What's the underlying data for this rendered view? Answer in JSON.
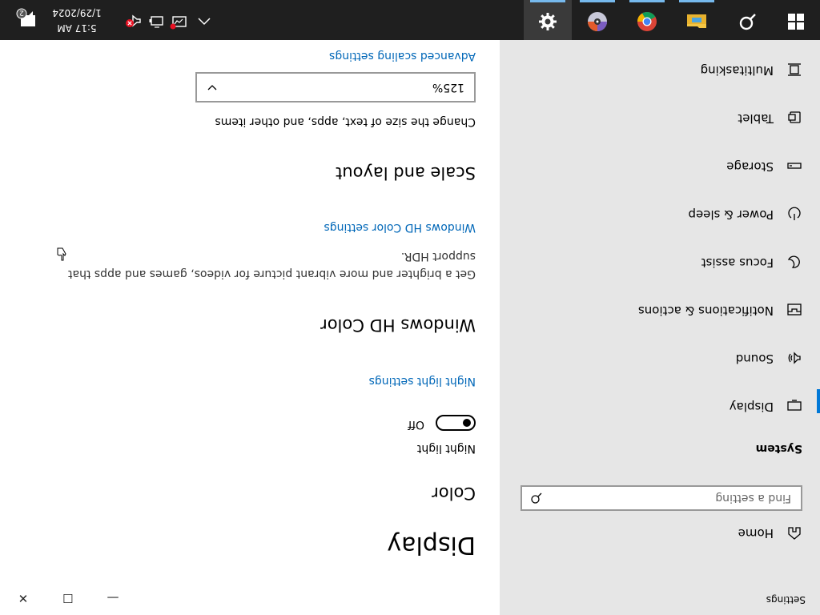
{
  "app": {
    "title": "Settings"
  },
  "sidebar": {
    "home_label": "Home",
    "search_placeholder": "Find a setting",
    "section_label": "System",
    "items": [
      {
        "label": "Display",
        "icon": "display-icon",
        "active": true
      },
      {
        "label": "Sound",
        "icon": "sound-icon"
      },
      {
        "label": "Notifications & actions",
        "icon": "notifications-icon"
      },
      {
        "label": "Focus assist",
        "icon": "focus-assist-icon"
      },
      {
        "label": "Power & sleep",
        "icon": "power-icon"
      },
      {
        "label": "Storage",
        "icon": "storage-icon"
      },
      {
        "label": "Tablet",
        "icon": "tablet-icon"
      },
      {
        "label": "Multitasking",
        "icon": "multitasking-icon"
      }
    ]
  },
  "window_controls": {
    "minimize": "—",
    "maximize": "☐",
    "close": "✕"
  },
  "main": {
    "title": "Display",
    "color_heading": "Color",
    "night_light_label": "Night light",
    "night_light_state": "Off",
    "night_light_on": false,
    "night_light_link": "Night light settings",
    "hd_color_heading": "Windows HD Color",
    "hd_color_desc_1": "Get a brighter and more vibrant picture for videos, games and apps that",
    "hd_color_desc_2": "support HDR.",
    "hd_color_link": "Windows HD Color settings",
    "scale_heading": "Scale and layout",
    "scale_desc": "Change the size of text, apps, and other items",
    "scale_value": "125%",
    "advanced_scaling_link": "Advanced scaling settings"
  },
  "taskbar": {
    "apps": [
      "start-icon",
      "search-icon",
      "file-explorer-icon",
      "chrome-icon",
      "media-player-icon",
      "settings-icon"
    ],
    "active_app": "settings-icon",
    "time": "5:17 AM",
    "date": "1/29/2024",
    "notification_count": "2",
    "accent": "#0078d7"
  }
}
